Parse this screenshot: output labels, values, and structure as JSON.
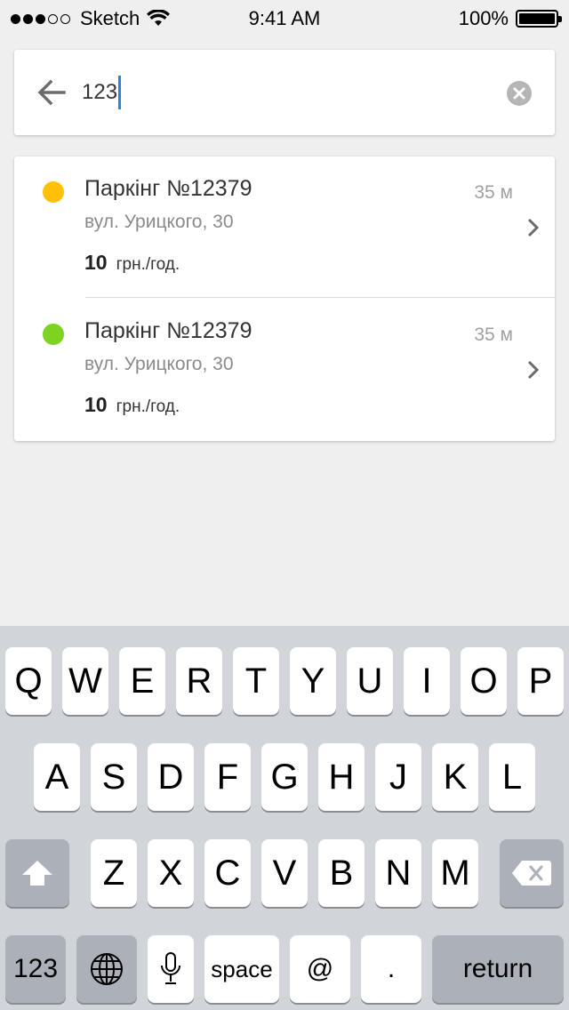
{
  "status_bar": {
    "carrier": "Sketch",
    "time": "9:41 AM",
    "battery_percent": "100%",
    "signal_bars_filled": 3,
    "signal_bars_total": 5
  },
  "search": {
    "query": "123",
    "icons": {
      "back": "arrow-left-icon",
      "clear": "clear-circle-icon"
    }
  },
  "results": [
    {
      "status_color": "#FFC107",
      "title": "Паркінг №12379",
      "address": "вул. Урицкого, 30",
      "price": "10",
      "price_unit": "грн./год.",
      "distance": "35 м"
    },
    {
      "status_color": "#7ED321",
      "title": "Паркінг №12379",
      "address": "вул. Урицкого, 30",
      "price": "10",
      "price_unit": "грн./год.",
      "distance": "35 м"
    }
  ],
  "keyboard": {
    "row1": [
      "Q",
      "W",
      "E",
      "R",
      "T",
      "Y",
      "U",
      "I",
      "O",
      "P"
    ],
    "row2": [
      "A",
      "S",
      "D",
      "F",
      "G",
      "H",
      "J",
      "K",
      "L"
    ],
    "row3": [
      "Z",
      "X",
      "C",
      "V",
      "B",
      "N",
      "M"
    ],
    "numbers_key": "123",
    "space_key": "space",
    "at_key": "@",
    "period_key": ".",
    "return_key": "return"
  }
}
